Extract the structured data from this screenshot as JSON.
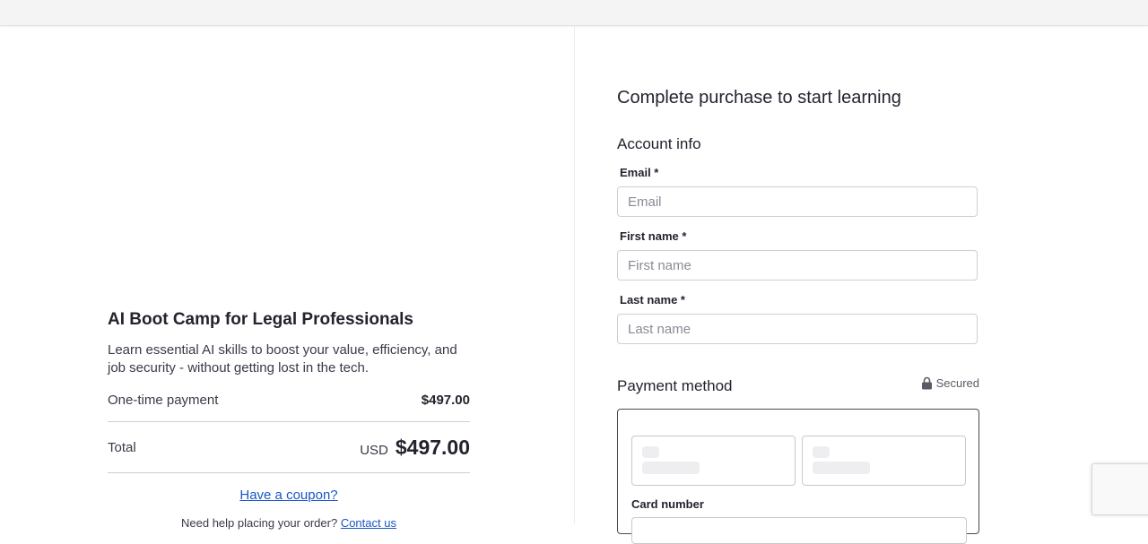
{
  "product": {
    "title": "AI Boot Camp for Legal Professionals",
    "description": "Learn essential AI skills to boost your value, efficiency, and job security - without getting lost in the tech.",
    "one_time_label": "One-time payment",
    "one_time_price": "$497.00",
    "total_label": "Total",
    "total_currency": "USD",
    "total_value": "$497.00",
    "coupon_link": "Have a coupon?",
    "help_text": "Need help placing your order?",
    "help_link": "Contact us"
  },
  "checkout": {
    "heading": "Complete purchase to start learning",
    "account_section": "Account info",
    "email": {
      "label": "Email *",
      "placeholder": "Email",
      "value": ""
    },
    "first_name": {
      "label": "First name *",
      "placeholder": "First name",
      "value": ""
    },
    "last_name": {
      "label": "Last name *",
      "placeholder": "Last name",
      "value": ""
    },
    "payment_section": "Payment method",
    "secured_label": "Secured",
    "card_number_label": "Card number"
  },
  "icons": {
    "secured": "lock-icon"
  },
  "colors": {
    "link": "#1a56c8",
    "text": "#23232f",
    "border": "#cfcfd6"
  }
}
